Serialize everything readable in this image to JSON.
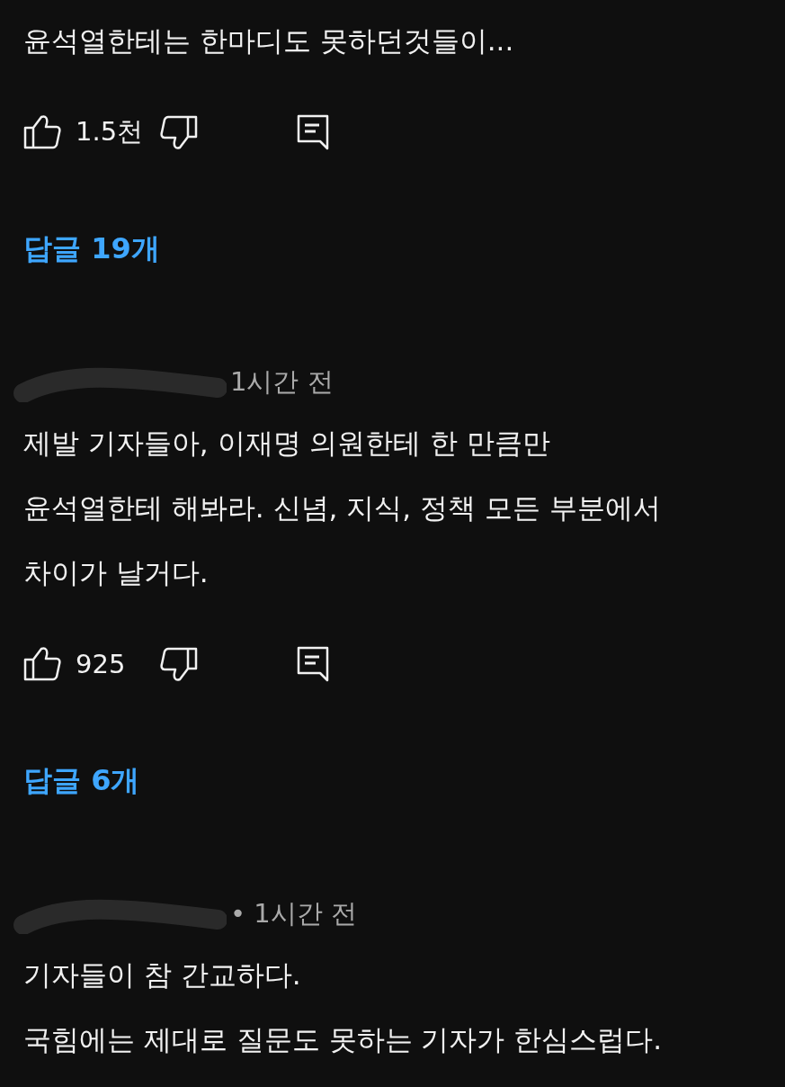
{
  "comments": [
    {
      "lines": [
        "윤석열한테는 한마디도 못하던것들이..."
      ],
      "likes": "1.5천",
      "replies": "답글 19개"
    },
    {
      "time": "1시간 전",
      "lines": [
        "제발 기자들아, 이재명 의원한테 한 만큼만",
        "윤석열한테 해봐라. 신념, 지식, 정책 모든 부분에서",
        "차이가 날거다."
      ],
      "likes": "925",
      "replies": "답글 6개"
    },
    {
      "time": "• 1시간 전",
      "lines": [
        "기자들이 참 간교하다.",
        "국힘에는 제대로 질문도 못하는 기자가 한심스럽다."
      ]
    }
  ]
}
